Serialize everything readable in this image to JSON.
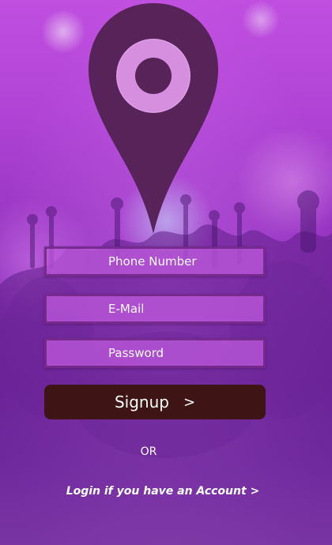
{
  "form": {
    "phone_placeholder": "Phone Number",
    "email_placeholder": "E-Mail",
    "password_placeholder": "Password"
  },
  "signup_button": {
    "label": "Signup",
    "chevron": ">"
  },
  "separator": {
    "text": "OR"
  },
  "login_link": {
    "text": "Login if you have an Account >"
  },
  "icons": {
    "logo": "location-pin-icon"
  },
  "colors": {
    "pin": "#582358",
    "pin_hole_ring": "#d58fde",
    "field_background": "#be5adc",
    "field_border": "#641e78",
    "button_background": "#3e1414",
    "text": "#ffffff"
  }
}
